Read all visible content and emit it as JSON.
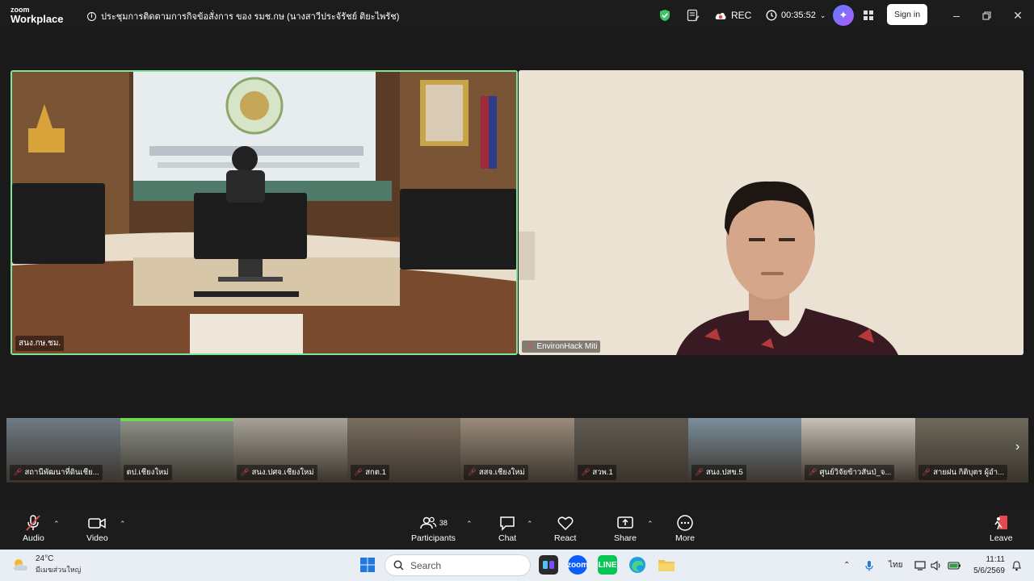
{
  "app": {
    "logo_top": "zoom",
    "logo_bottom": "Workplace"
  },
  "meeting": {
    "title": "ประชุมการติดตามการกิจข้อสั่งการ ของ รมช.กษ (นางสาวีประจัรัชย์ ติยะไพรัช)"
  },
  "titlebar": {
    "rec_label": "REC",
    "timer": "00:35:52",
    "signin_label": "Sign in"
  },
  "main_tiles": [
    {
      "name": "สนง.กษ.ชม."
    },
    {
      "name": "EnvironHack Miti"
    }
  ],
  "filmstrip": [
    {
      "name": "สถานีพัฒนาที่ดินเชีย...",
      "bg": "#6e7b86"
    },
    {
      "name": "ตป.เชียงใหม่",
      "bg": "#8a8f86"
    },
    {
      "name": "สนง.ปศจ.เชียงใหม่",
      "bg": "#a8a39a"
    },
    {
      "name": "สกต.1",
      "bg": "#7a6d5e"
    },
    {
      "name": "สสจ.เชียงใหม่",
      "bg": "#9a8c7b"
    },
    {
      "name": "สวพ.1",
      "bg": "#5f5a52"
    },
    {
      "name": "สนง.ปสข.5",
      "bg": "#7a8e9a"
    },
    {
      "name": "ศูนย์วิจัยข้าวสันป่_จ...",
      "bg": "#c9c2b8"
    },
    {
      "name": "สายฝน กิติบุตร ผู้อำ...",
      "bg": "#6d6a5c"
    }
  ],
  "toolbar": {
    "audio_label": "Audio",
    "video_label": "Video",
    "participants_label": "Participants",
    "participants_count": "38",
    "chat_label": "Chat",
    "react_label": "React",
    "share_label": "Share",
    "more_label": "More",
    "leave_label": "Leave"
  },
  "taskbar": {
    "weather_temp": "24°C",
    "weather_location": "มีเมฆส่วนใหญ่",
    "search_placeholder": "Search",
    "language": "ไทย",
    "time": "11:11",
    "date": "5/6/2569"
  },
  "colors": {
    "active_speaker": "#7fe59a",
    "mic_muted": "#e54b4b",
    "titlebar": "#1c1c1c"
  }
}
